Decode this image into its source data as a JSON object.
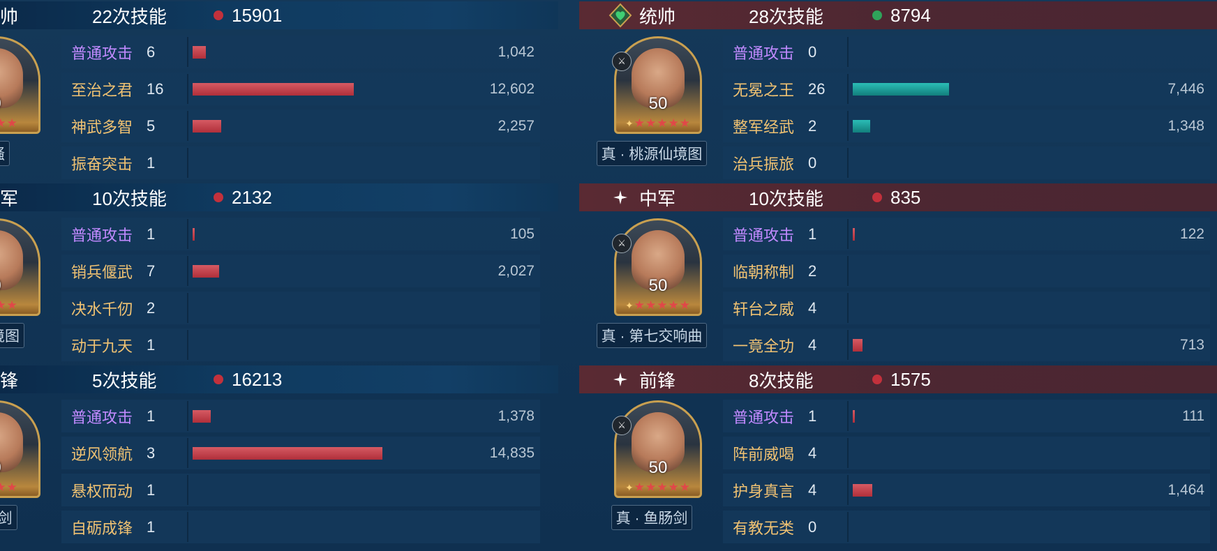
{
  "left": {
    "sections": [
      {
        "role": "帅",
        "skill_count": "22次技能",
        "total": "15901",
        "total_dot": "#c2313c",
        "portrait": {
          "level": "0",
          "stars": "★★★",
          "caption": "离骚"
        },
        "rows": [
          {
            "name": "普通攻击",
            "count": "6",
            "damage": "1,042",
            "bar": 0.028,
            "normal": true
          },
          {
            "name": "至治之君",
            "count": "16",
            "damage": "12,602",
            "bar": 0.34,
            "normal": false
          },
          {
            "name": "神武多智",
            "count": "5",
            "damage": "2,257",
            "bar": 0.061,
            "normal": false
          },
          {
            "name": "振奋突击",
            "count": "1",
            "damage": "",
            "bar": 0,
            "normal": false
          }
        ]
      },
      {
        "role": "军",
        "skill_count": "10次技能",
        "total": "2132",
        "total_dot": "#c2313c",
        "portrait": {
          "level": "0",
          "stars": "★★★",
          "caption": "源仙境图"
        },
        "rows": [
          {
            "name": "普通攻击",
            "count": "1",
            "damage": "105",
            "bar": 0.003,
            "normal": true
          },
          {
            "name": "销兵偃武",
            "count": "7",
            "damage": "2,027",
            "bar": 0.056,
            "normal": false
          },
          {
            "name": "决水千仞",
            "count": "2",
            "damage": "",
            "bar": 0,
            "normal": false
          },
          {
            "name": "动于九天",
            "count": "1",
            "damage": "",
            "bar": 0,
            "normal": false
          }
        ]
      },
      {
        "role": "锋",
        "skill_count": "5次技能",
        "total": "16213",
        "total_dot": "#c2313c",
        "portrait": {
          "level": "0",
          "stars": "★★★",
          "caption": "鱼肠剑"
        },
        "rows": [
          {
            "name": "普通攻击",
            "count": "1",
            "damage": "1,378",
            "bar": 0.038,
            "normal": true
          },
          {
            "name": "逆风领航",
            "count": "3",
            "damage": "14,835",
            "bar": 0.4,
            "normal": false
          },
          {
            "name": "悬权而动",
            "count": "1",
            "damage": "",
            "bar": 0,
            "normal": false
          },
          {
            "name": "自砺成锋",
            "count": "1",
            "damage": "",
            "bar": 0,
            "normal": false
          }
        ]
      }
    ]
  },
  "right": {
    "sections": [
      {
        "icon": "heart-emblem-icon",
        "role": "统帅",
        "skill_count": "28次技能",
        "total": "8794",
        "total_dot": "#2fa35a",
        "portrait": {
          "level": "50",
          "stars": "★★★★★",
          "caption": "真 · 桃源仙境图"
        },
        "bar_color": "teal",
        "rows": [
          {
            "name": "普通攻击",
            "count": "0",
            "damage": "",
            "bar": 0,
            "normal": true
          },
          {
            "name": "无冕之王",
            "count": "26",
            "damage": "7,446",
            "bar": 0.2,
            "normal": false
          },
          {
            "name": "整军经武",
            "count": "2",
            "damage": "1,348",
            "bar": 0.036,
            "normal": false
          },
          {
            "name": "治兵振旅",
            "count": "0",
            "damage": "",
            "bar": 0,
            "normal": false
          }
        ]
      },
      {
        "icon": "sparkle-icon",
        "role": "中军",
        "skill_count": "10次技能",
        "total": "835",
        "total_dot": "#c2313c",
        "portrait": {
          "level": "50",
          "stars": "★★★★★",
          "caption": "真 · 第七交响曲"
        },
        "bar_color": "red",
        "rows": [
          {
            "name": "普通攻击",
            "count": "1",
            "damage": "122",
            "bar": 0.003,
            "normal": true
          },
          {
            "name": "临朝称制",
            "count": "2",
            "damage": "",
            "bar": 0,
            "normal": false
          },
          {
            "name": "轩台之威",
            "count": "4",
            "damage": "",
            "bar": 0,
            "normal": false
          },
          {
            "name": "一竟全功",
            "count": "4",
            "damage": "713",
            "bar": 0.02,
            "normal": false
          }
        ]
      },
      {
        "icon": "sparkle-icon",
        "role": "前锋",
        "skill_count": "8次技能",
        "total": "1575",
        "total_dot": "#c2313c",
        "portrait": {
          "level": "50",
          "stars": "★★★★★",
          "caption": "真 · 鱼肠剑"
        },
        "bar_color": "red",
        "rows": [
          {
            "name": "普通攻击",
            "count": "1",
            "damage": "111",
            "bar": 0.003,
            "normal": true
          },
          {
            "name": "阵前威喝",
            "count": "4",
            "damage": "",
            "bar": 0,
            "normal": false
          },
          {
            "name": "护身真言",
            "count": "4",
            "damage": "1,464",
            "bar": 0.04,
            "normal": false
          },
          {
            "name": "有教无类",
            "count": "0",
            "damage": "",
            "bar": 0,
            "normal": false
          }
        ]
      }
    ]
  }
}
